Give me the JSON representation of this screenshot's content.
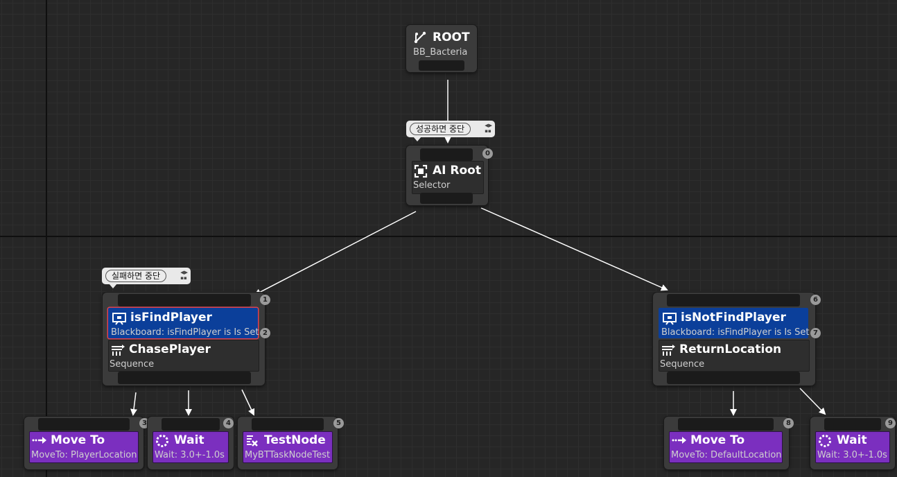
{
  "root": {
    "title": "ROOT",
    "subtitle": "BB_Bacteria"
  },
  "ai_root": {
    "index": "0",
    "title": "AI Root",
    "subtitle": "Selector",
    "comment": "성공하면 중단"
  },
  "chase": {
    "comment": "실패하면 중단",
    "decorator": {
      "index": "1",
      "title": "isFindPlayer",
      "subtitle": "Blackboard: isFindPlayer is Is Set"
    },
    "composite": {
      "index": "2",
      "title": "ChasePlayer",
      "subtitle": "Sequence"
    }
  },
  "return": {
    "decorator": {
      "index": "6",
      "title": "isNotFindPlayer",
      "subtitle": "Blackboard: isFindPlayer is Is Set"
    },
    "composite": {
      "index": "7",
      "title": "ReturnLocation",
      "subtitle": "Sequence"
    }
  },
  "tasks": [
    {
      "index": "3",
      "title": "Move To",
      "subtitle": "MoveTo: PlayerLocation",
      "icon": "move-to-icon"
    },
    {
      "index": "4",
      "title": "Wait",
      "subtitle": "Wait: 3.0+-1.0s",
      "icon": "wait-icon"
    },
    {
      "index": "5",
      "title": "TestNode",
      "subtitle": "MyBTTaskNodeTest",
      "icon": "task-icon"
    },
    {
      "index": "8",
      "title": "Move To",
      "subtitle": "MoveTo: DefaultLocation",
      "icon": "move-to-icon"
    },
    {
      "index": "9",
      "title": "Wait",
      "subtitle": "Wait: 3.0+-1.0s",
      "icon": "wait-icon"
    }
  ],
  "colors": {
    "canvas": "#262626",
    "decorator": "#0b3f9a",
    "task": "#7b2fbf",
    "selected_outline": "#e0414f",
    "wire": "#ffffff"
  }
}
